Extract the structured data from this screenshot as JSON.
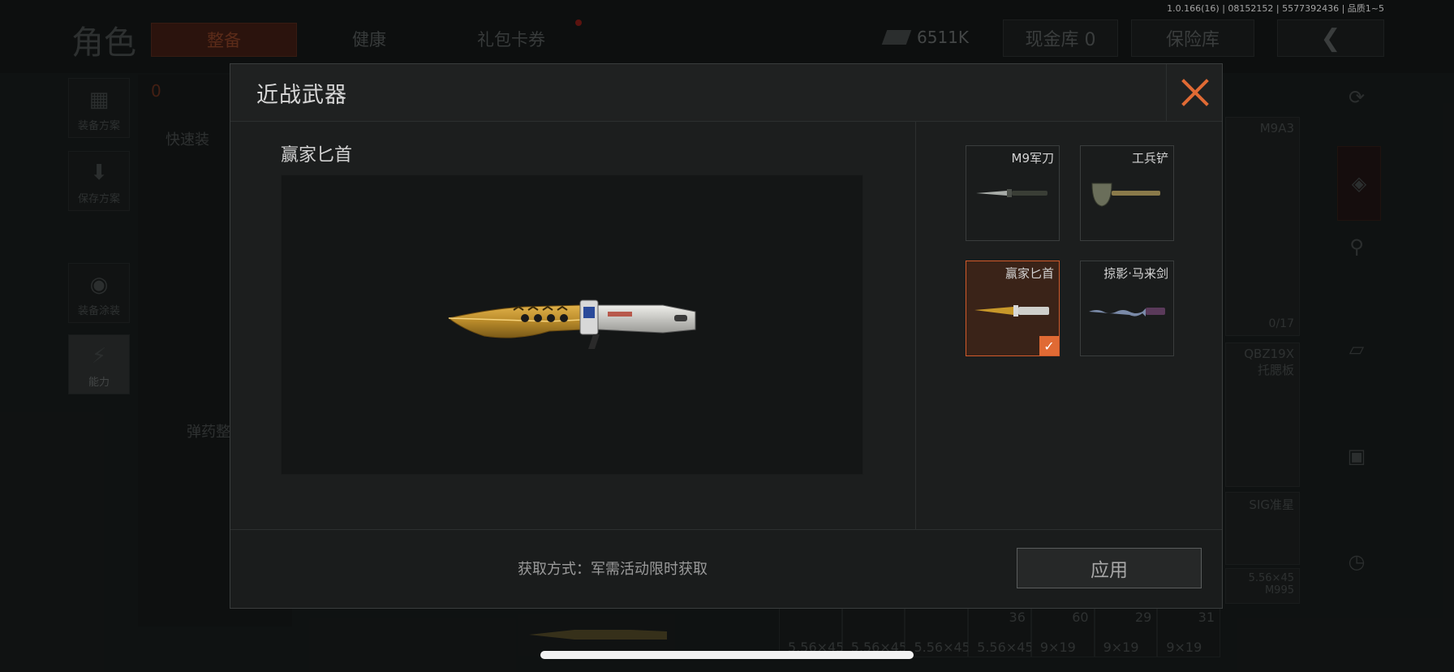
{
  "version_info": "1.0.166(16) | 08152152 | 5577392436 | 品质1~5",
  "background": {
    "title": "角色",
    "tabs": [
      {
        "label": "整备"
      },
      {
        "label": "健康"
      },
      {
        "label": "礼包卡券"
      }
    ],
    "money": "6511K",
    "cash_vault": "现金库 0",
    "safe_vault": "保险库",
    "left_nav": [
      {
        "label": "装备方案"
      },
      {
        "label": "保存方案"
      },
      {
        "label": "装备涂装"
      },
      {
        "label": "能力"
      }
    ],
    "left_panel": {
      "armor_count": "0",
      "quick_equip": "快速装",
      "ammo_equip": "弹药整"
    },
    "right_cells": [
      {
        "label": "M9A3",
        "count": "0/17"
      },
      {
        "label": "QBZ19X 托腮板"
      },
      {
        "label": "SIG准星"
      },
      {
        "label": "5.56×45 M995"
      }
    ],
    "bottom_ammo": [
      {
        "caliber": "5.56×45",
        "count": ""
      },
      {
        "caliber": "5.56×45",
        "count": ""
      },
      {
        "caliber": "5.56×45",
        "count": ""
      },
      {
        "caliber": "5.56×45",
        "count": "36"
      },
      {
        "caliber": "9×19",
        "count": "60"
      },
      {
        "caliber": "9×19",
        "count": "29"
      },
      {
        "caliber": "9×19",
        "count": "31"
      }
    ]
  },
  "modal": {
    "title": "近战武器",
    "selected_item_name": "赢家匕首",
    "acquire_text": "获取方式：军需活动限时获取",
    "apply_label": "应用",
    "cards": [
      {
        "name": "M9军刀",
        "selected": false
      },
      {
        "name": "工兵铲",
        "selected": false
      },
      {
        "name": "赢家匕首",
        "selected": true
      },
      {
        "name": "掠影·马来剑",
        "selected": false
      }
    ],
    "colors": {
      "accent": "#e06a34",
      "selected_bg": "#3a2318"
    }
  }
}
